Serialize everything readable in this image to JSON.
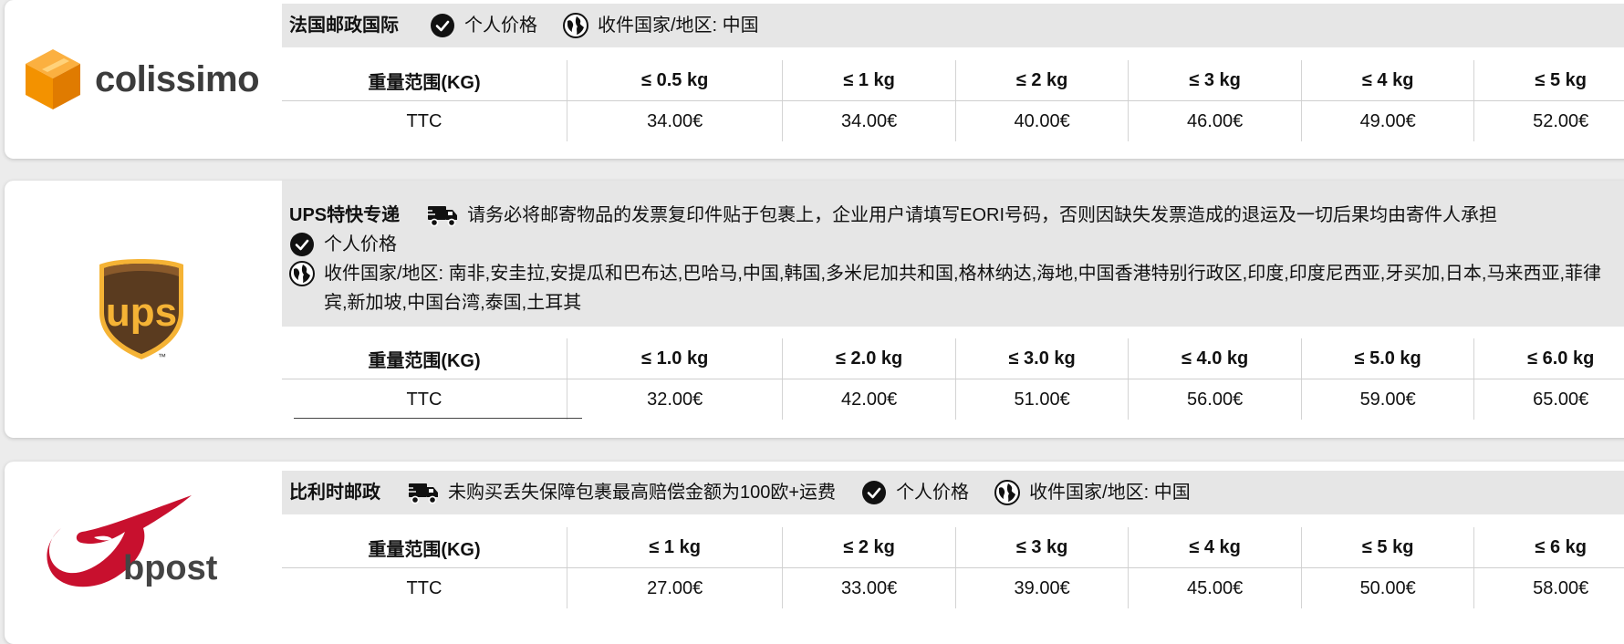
{
  "cards": [
    {
      "logo": {
        "name": "colissimo",
        "wordmark": "colissimo"
      },
      "carrier": "法国邮政国际",
      "tags": [
        "个人价格",
        "收件国家/地区: 中国"
      ],
      "table": {
        "header": [
          "重量范围(KG)",
          "≤ 0.5 kg",
          "≤ 1 kg",
          "≤ 2 kg",
          "≤ 3 kg",
          "≤ 4 kg",
          "≤ 5 kg"
        ],
        "row": [
          "TTC",
          "34.00€",
          "34.00€",
          "40.00€",
          "46.00€",
          "49.00€",
          "52.00€"
        ]
      }
    },
    {
      "logo": {
        "name": "ups",
        "wordmark": "ups",
        "trademark": "™"
      },
      "carrier": "UPS特快专递",
      "notice": "请务必将邮寄物品的发票复印件贴于包裹上，企业用户请填写EORI号码，否则因缺失发票造成的退运及一切后果均由寄件人承担",
      "tags": [
        "个人价格"
      ],
      "countries": "收件国家/地区: 南非,安圭拉,安提瓜和巴布达,巴哈马,中国,韩国,多米尼加共和国,格林纳达,海地,中国香港特别行政区,印度,印度尼西亚,牙买加,日本,马来西亚,菲律宾,新加坡,中国台湾,泰国,土耳其",
      "table": {
        "header": [
          "重量范围(KG)",
          "≤ 1.0 kg",
          "≤ 2.0 kg",
          "≤ 3.0 kg",
          "≤ 4.0 kg",
          "≤ 5.0 kg",
          "≤ 6.0 kg"
        ],
        "row": [
          "TTC",
          "32.00€",
          "42.00€",
          "51.00€",
          "56.00€",
          "59.00€",
          "65.00€"
        ]
      }
    },
    {
      "logo": {
        "name": "bpost",
        "wordmark": "bpost"
      },
      "carrier": "比利时邮政",
      "notice": "未购买丢失保障包裹最高赔偿金额为100欧+运费",
      "tags": [
        "个人价格",
        "收件国家/地区: 中国"
      ],
      "table": {
        "header": [
          "重量范围(KG)",
          "≤ 1 kg",
          "≤ 2 kg",
          "≤ 3 kg",
          "≤ 4 kg",
          "≤ 5 kg",
          "≤ 6 kg"
        ],
        "row": [
          "TTC",
          "27.00€",
          "33.00€",
          "39.00€",
          "45.00€",
          "50.00€",
          "58.00€"
        ]
      }
    }
  ],
  "colors": {
    "colissimo_orange": "#f39200",
    "ups_brown": "#5a3b1f",
    "ups_gold": "#f5b335",
    "bpost_red": "#c8102e"
  }
}
